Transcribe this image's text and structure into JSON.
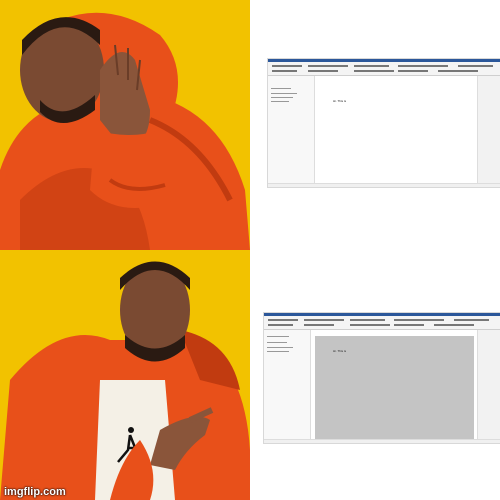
{
  "meme": {
    "template": "drake",
    "watermark": "imgflip.com",
    "colors": {
      "background": "#f2c200",
      "jacket": "#e8501a",
      "jacket_shadow": "#c13b10",
      "skin": "#7a4a32",
      "tshirt": "#f4f0e6"
    }
  },
  "top_right": {
    "doc_text": "Hi. This is"
  },
  "bottom_right": {
    "doc_text": "Hi. This is"
  }
}
